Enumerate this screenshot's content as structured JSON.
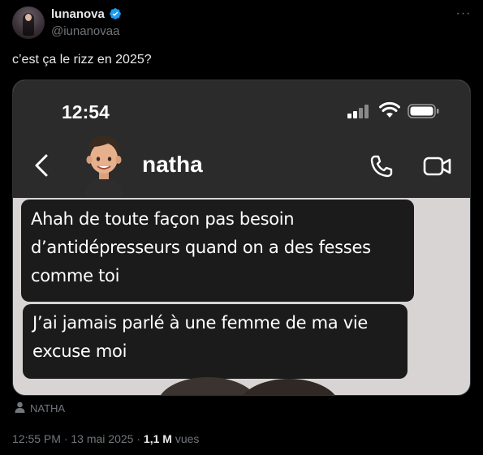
{
  "author": {
    "display_name": "lunanova",
    "handle": "@iunanovaa",
    "verified_icon": "verified-badge-icon"
  },
  "tweet": {
    "text": "c’est ça le rizz en 2025?"
  },
  "media": {
    "status_bar": {
      "time": "12:54"
    },
    "chat_header": {
      "name": "natha"
    },
    "messages": [
      {
        "lines": [
          "Ahah de toute façon pas besoin",
          "d’antidépresseurs quand on a des fesses",
          "comme toi"
        ]
      },
      {
        "lines": [
          "J’ai jamais parlé à une femme de ma vie",
          "excuse moi"
        ]
      }
    ],
    "attribution": "NATHA"
  },
  "meta": {
    "time": "12:55 PM",
    "separator": "·",
    "date": "13 mai 2025",
    "views_count": "1,1 M",
    "views_label": "vues"
  },
  "colors": {
    "background": "#000000",
    "text_primary": "#e7e9ea",
    "text_secondary": "#71767b",
    "verified": "#1d9bf0",
    "bubble": "#1b1b1b"
  }
}
